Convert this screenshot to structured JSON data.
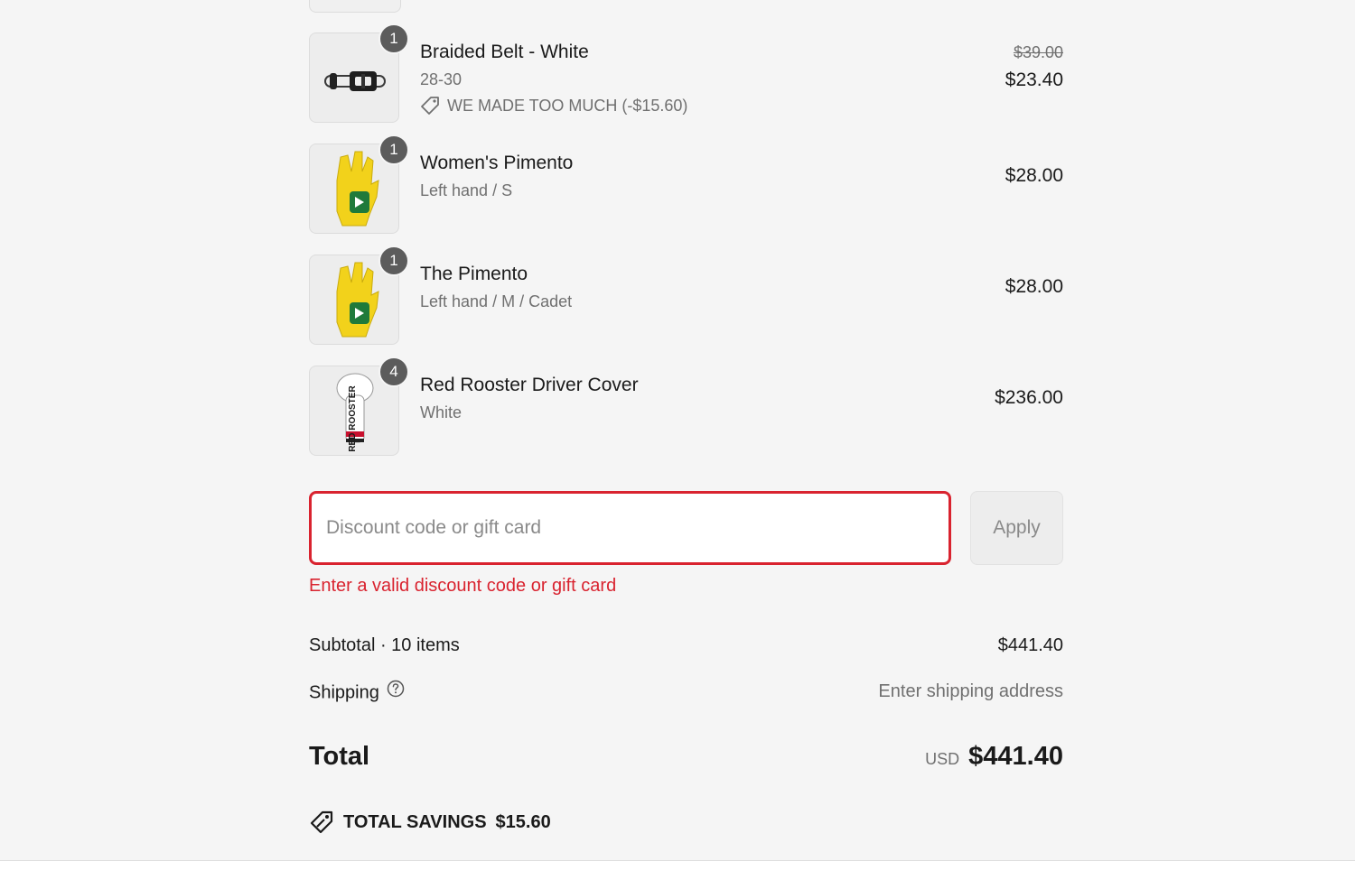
{
  "items": [
    {
      "name": "Braided Belt - White",
      "variant": "28-30",
      "quantity": "1",
      "discount": "WE MADE TOO MUCH (-$15.60)",
      "original_price": "$39.00",
      "price": "$23.40",
      "image_icon": "belt-image"
    },
    {
      "name": "Women's Pimento",
      "variant": "Left hand / S",
      "quantity": "1",
      "price": "$28.00",
      "image_icon": "glove-image"
    },
    {
      "name": "The Pimento",
      "variant": "Left hand / M / Cadet",
      "quantity": "1",
      "price": "$28.00",
      "image_icon": "glove-image"
    },
    {
      "name": "Red Rooster Driver Cover",
      "variant": "White",
      "quantity": "4",
      "price": "$236.00",
      "image_icon": "headcover-image",
      "image_text": "RED ROOSTER"
    }
  ],
  "discount": {
    "placeholder": "Discount code or gift card",
    "value": "",
    "apply_label": "Apply",
    "error": "Enter a valid discount code or gift card"
  },
  "summary": {
    "subtotal_label": "Subtotal · 10 items",
    "subtotal_value": "$441.40",
    "shipping_label": "Shipping",
    "shipping_value": "Enter shipping address",
    "total_label": "Total",
    "total_currency": "USD",
    "total_value": "$441.40",
    "savings_label": "TOTAL SAVINGS",
    "savings_value": "$15.60"
  },
  "colors": {
    "error": "#d9232f",
    "badge": "#5c5c5c",
    "glove": "#f2d21b",
    "glove_logo": "#1f7a3a",
    "rooster_red": "#c8102e"
  }
}
